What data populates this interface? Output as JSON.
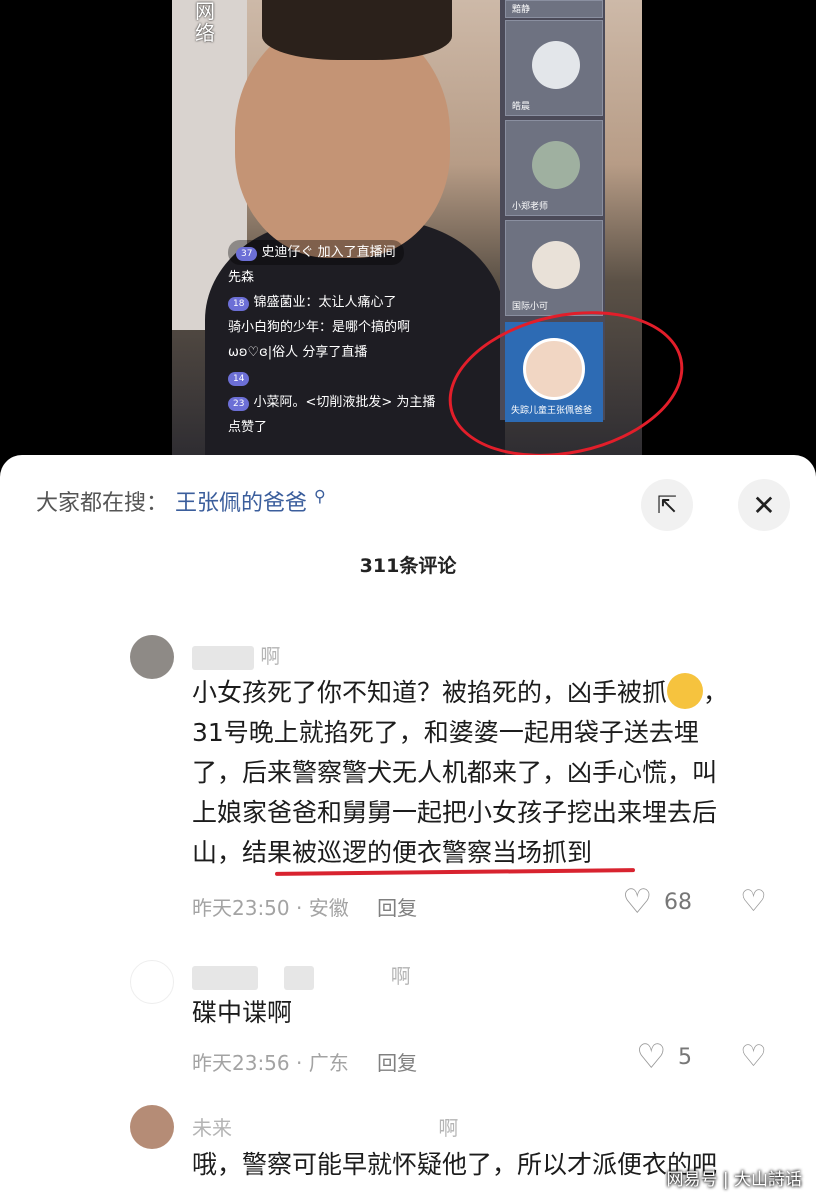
{
  "video": {
    "watermark": "网络",
    "guests": [
      {
        "rank": "",
        "name": "黯静"
      },
      {
        "rank": "",
        "name": "皓晨"
      },
      {
        "rank": "",
        "name": "小郑老师"
      },
      {
        "rank": "",
        "name": "国际小可"
      }
    ],
    "special_guest": {
      "name": "失踪儿童王张佩爸爸"
    },
    "chat": [
      {
        "level": "37",
        "text": "史迪仔ぐ 加入了直播间"
      },
      {
        "level": "",
        "text": "先森"
      },
      {
        "level": "18",
        "text": "锦盛菌业：太让人痛心了"
      },
      {
        "level": "",
        "text": "骑小白狗的少年：是哪个搞的啊"
      },
      {
        "level": "",
        "text": "ωʚ♡ɞ|俗人 分享了直播"
      },
      {
        "level": "14",
        "text": ""
      },
      {
        "level": "23",
        "text": "小菜阿。<切削液批发> 为主播"
      },
      {
        "level": "",
        "text": "点赞了"
      }
    ]
  },
  "sheet": {
    "search_label": "大家都在搜：",
    "search_keyword": "王张佩的爸爸",
    "comment_count": "311条评论",
    "comments": [
      {
        "name_suffix": "啊",
        "text_lines": [
          "小女孩死了你不知道？被掐死的，凶手被抓",
          "31号晚上就掐死了，和婆婆一起用袋子送去埋",
          "了，后来警察警犬无人机都来了，凶手心慌，叫",
          "上娘家爸爸和舅舅一起把小女孩子挖出来埋去后",
          "山，结果被巡逻的便衣警察当场抓到"
        ],
        "time": "昨天23:50",
        "location": "安徽",
        "reply": "回复",
        "likes": "68"
      },
      {
        "name_suffix": "啊",
        "text_lines": [
          "碟中谍啊"
        ],
        "time": "昨天23:56",
        "location": "广东",
        "reply": "回复",
        "likes": "5"
      },
      {
        "name": "未来",
        "name_suffix": "啊",
        "text_lines": [
          "哦，警察可能早就怀疑他了，所以才派便衣的吧"
        ]
      }
    ],
    "corner_watermark": "网易号 | 大山詩话"
  }
}
